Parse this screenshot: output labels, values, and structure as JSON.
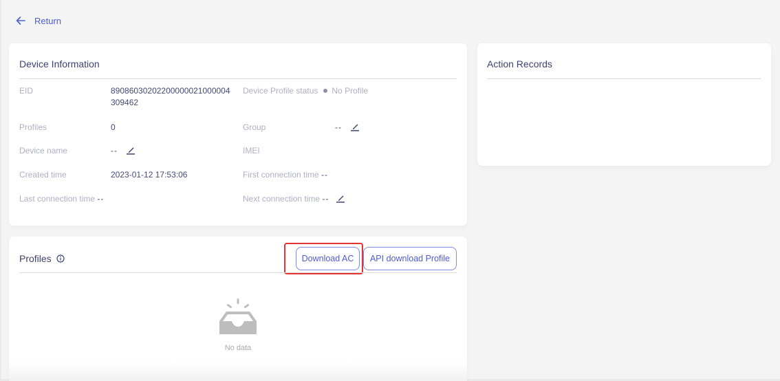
{
  "nav": {
    "return_label": "Return"
  },
  "colors": {
    "accent": "#4d5cd6",
    "highlight": "#e53232",
    "label": "#aeb0c4",
    "value": "#444a74"
  },
  "device_info": {
    "title": "Device Information",
    "eid_label": "EID",
    "eid_value": "89086030202200000021000004309462",
    "profile_status_label": "Device Profile status",
    "profile_status_value": "No Profile",
    "profiles_label": "Profiles",
    "profiles_value": "0",
    "group_label": "Group",
    "group_value": "--",
    "device_name_label": "Device name",
    "device_name_value": "--",
    "imei_label": "IMEI",
    "imei_value": "",
    "created_time_label": "Created time",
    "created_time_value": "2023-01-12 17:53:06",
    "first_connection_label": "First connection time",
    "first_connection_value": "--",
    "last_connection_label": "Last connection time",
    "last_connection_value": "--",
    "next_connection_label": "Next connection time",
    "next_connection_value": "--"
  },
  "action_records": {
    "title": "Action Records"
  },
  "profiles": {
    "title": "Profiles",
    "info_icon": "info-icon",
    "buttons": {
      "download_ac": "Download AC",
      "api_download_profile": "API download Profile"
    },
    "empty_text": "No data"
  }
}
